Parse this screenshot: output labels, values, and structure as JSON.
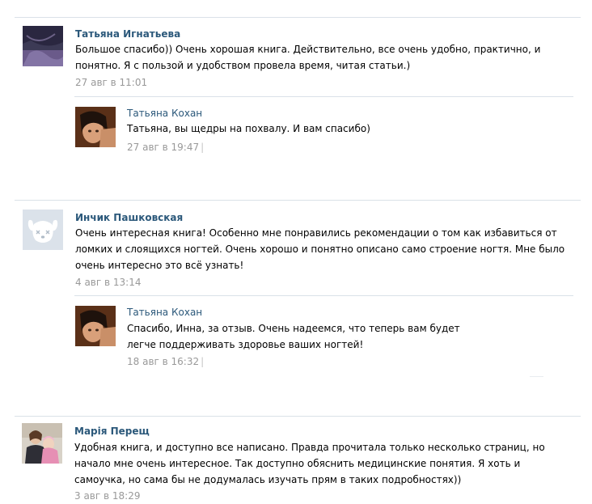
{
  "comments": [
    {
      "author": "Татьяна Игнатьева",
      "text": "Большое спасибо)) Очень хорошая книга. Действительно, все очень удобно, практично, и понятно. Я с пользой и удобством провела время, читая статьи.)",
      "date": "27 авг в 11:01",
      "reply": {
        "author": "Татьяна Кохан",
        "text": "Татьяна, вы щедры на похвалу. И вам спасибо)",
        "date": "27 авг в 19:47",
        "separator": "|"
      }
    },
    {
      "author": "Инчик Пашковская",
      "text": "Очень интересная книга! Особенно мне понравились рекомендации о том как избавиться от ломких и слоящихся ногтей. Очень хорошо и понятно описано само строение ногтя. Мне было очень интересно это всё узнать!",
      "date": "4 авг в 13:14",
      "reply": {
        "author": "Татьяна Кохан",
        "text": "Спасибо, Инна, за отзыв. Очень надеемся, что теперь вам будет легче поддерживать здоровье ваших ногтей!",
        "date": "18 авг в 16:32",
        "separator": "|"
      }
    },
    {
      "author": "Марія Перещ",
      "text": "Удобная книга, и доступно все написано. Правда прочитала только несколько страниц, но начало мне очень интересное. Так доступно обяснить медицинские понятия. Я хоть и самоучка, но сама бы не додумалась изучать прям в таких подробностях))",
      "date": "3 авг в 18:29"
    }
  ]
}
